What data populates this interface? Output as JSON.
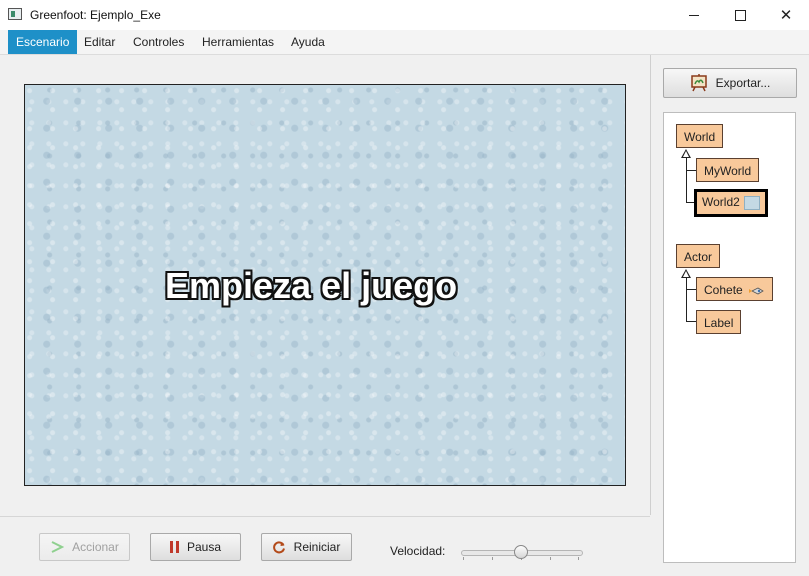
{
  "window": {
    "title": "Greenfoot: Ejemplo_Exe",
    "minimize_icon": "minimize-icon",
    "maximize_icon": "maximize-icon",
    "close_label": "✕"
  },
  "menu": {
    "items": [
      {
        "label": "Escenario",
        "active": true
      },
      {
        "label": "Editar",
        "active": false
      },
      {
        "label": "Controles",
        "active": false
      },
      {
        "label": "Herramientas",
        "active": false
      },
      {
        "label": "Ayuda",
        "active": false
      }
    ]
  },
  "world": {
    "text": "Empieza el juego",
    "background_color": "#c4d9e4"
  },
  "controls": {
    "act_label": "Accionar",
    "pause_label": "Pausa",
    "reset_label": "Reiniciar",
    "speed_label": "Velocidad:",
    "speed_value": 0.5
  },
  "export": {
    "label": "Exportar..."
  },
  "class_tree": {
    "world_group": {
      "root": "World",
      "children": [
        "MyWorld",
        "World2"
      ],
      "selected": "World2"
    },
    "actor_group": {
      "root": "Actor",
      "children": [
        "Cohete",
        "Label"
      ]
    }
  },
  "colors": {
    "menu_active": "#1e90c8",
    "class_box": "#f8c99b",
    "pause_icon": "#c0392b",
    "act_icon": "#5cc75c"
  }
}
